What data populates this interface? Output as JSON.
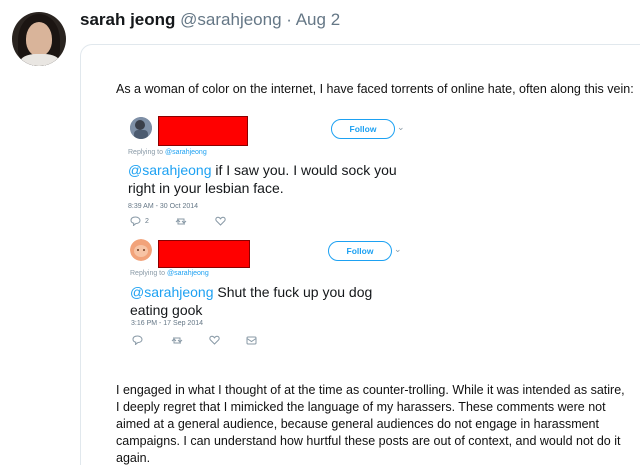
{
  "tweet": {
    "author_name": "sarah jeong",
    "author_handle": "@sarahjeong",
    "separator": " · ",
    "date": "Aug 2"
  },
  "media": {
    "intro_text": "As a woman of color on the internet, I have faced torrents of online hate, often along this vein:",
    "embedded": [
      {
        "follow_label": "Follow",
        "replying_prefix": "Replying to ",
        "replying_handle": "@sarahjeong",
        "mention": "@sarahjeong",
        "text": " if I saw you. I would sock you right in your lesbian face.",
        "timestamp": "8:39 AM - 30 Oct 2014",
        "reply_count": "2"
      },
      {
        "follow_label": "Follow",
        "replying_prefix": "Replying to ",
        "replying_handle": "@sarahjeong",
        "mention": "@sarahjeong",
        "text": " Shut the fuck up you dog eating gook",
        "timestamp": "3:16 PM - 17 Sep 2014",
        "reply_count": ""
      }
    ],
    "outro_text": "I engaged in what I thought of at the time as counter-trolling. While it was intended as satire, I deeply regret that I mimicked the language of my harassers. These comments were not aimed at a general audience, because general audiences do not engage in harassment campaigns. I can understand how hurtful these posts are out of context, and would not do it again."
  },
  "colors": {
    "link_blue": "#1da1f2",
    "redaction_red": "#ff0000",
    "muted_gray": "#657786"
  },
  "icons": [
    "reply-icon",
    "retweet-icon",
    "like-icon",
    "message-icon",
    "chevron-down-icon"
  ]
}
